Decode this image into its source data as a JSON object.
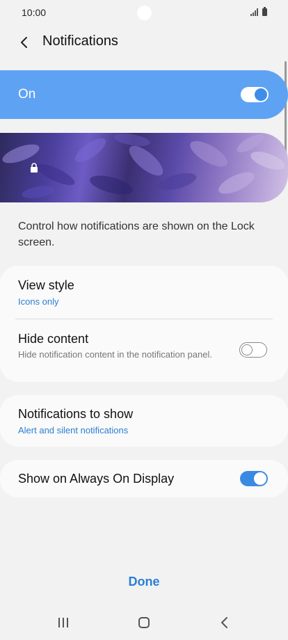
{
  "status_bar": {
    "time": "10:00"
  },
  "header": {
    "title": "Notifications"
  },
  "master_switch": {
    "label": "On",
    "state": "on"
  },
  "lock_preview": {
    "icon": "lock-icon"
  },
  "description": "Control how notifications are shown on the Lock screen.",
  "view_style": {
    "title": "View style",
    "value": "Icons only"
  },
  "hide_content": {
    "title": "Hide content",
    "subtitle": "Hide notification content in the notification panel.",
    "state": "off"
  },
  "notifications_to_show": {
    "title": "Notifications to show",
    "value": "Alert and silent notifications"
  },
  "always_on_display": {
    "title": "Show on Always On Display",
    "state": "on"
  },
  "done_label": "Done",
  "colors": {
    "accent": "#2a7fd4",
    "master_bg": "#5ea2f3",
    "background": "#f2f2f2"
  }
}
